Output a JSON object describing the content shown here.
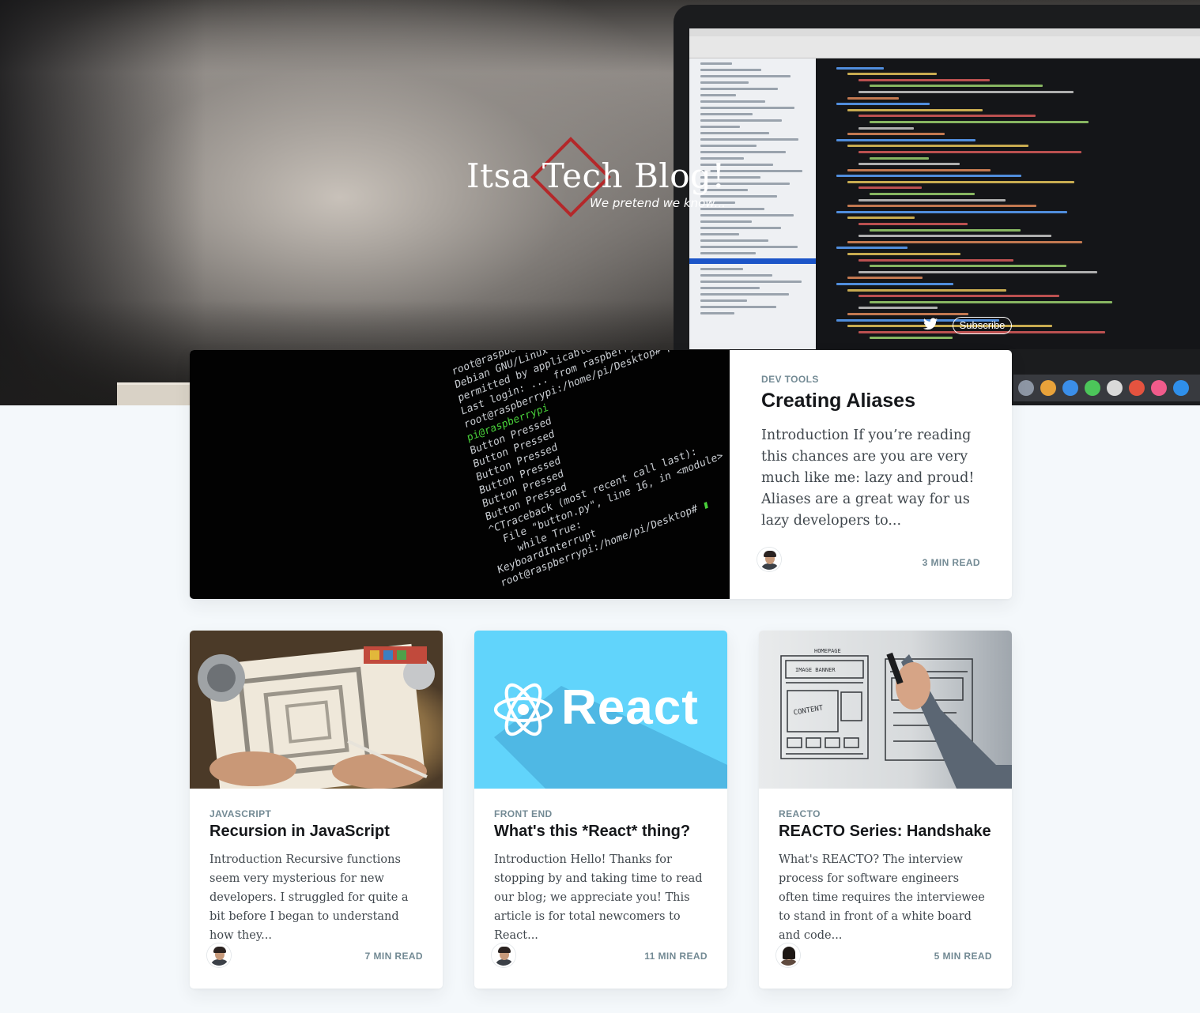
{
  "site": {
    "title": "Itsa Tech Blog!",
    "tagline": "We pretend we know...",
    "subscribe_label": "Subscribe",
    "accent_color": "#b4282a"
  },
  "feature": {
    "tag": "DEV TOOLS",
    "title": "Creating Aliases",
    "excerpt": "Introduction If you’re reading this chances are you are very much like me: lazy and proud! Aliases are a great way for us lazy developers to...",
    "read_time": "3 MIN READ"
  },
  "posts": [
    {
      "tag": "JAVASCRIPT",
      "title": "Recursion in JavaScript",
      "excerpt": "Introduction Recursive functions seem very mysterious for new developers. I struggled for quite a bit before I began to understand how they...",
      "read_time": "7 MIN READ"
    },
    {
      "tag": "FRONT END",
      "title": "What's this *React* thing?",
      "excerpt": "Introduction Hello! Thanks for stopping by and taking time to read our blog; we appreciate you! This article is for total newcomers to React...",
      "read_time": "11 MIN READ",
      "image_text": "React"
    },
    {
      "tag": "REACTO",
      "title": "REACTO Series: Handshake",
      "excerpt": "What's REACTO? The interview process for software engineers often time requires the interviewee to stand in front of a white board and code...",
      "read_time": "5 MIN READ"
    }
  ]
}
